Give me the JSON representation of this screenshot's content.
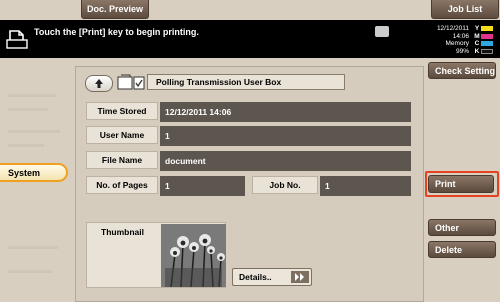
{
  "top": {
    "doc_preview": "Doc. Preview",
    "job_list": "Job List"
  },
  "message": {
    "text": "Touch the [Print] key to begin printing."
  },
  "status": {
    "date": "12/12/2011",
    "time": "14:06",
    "memory_label": "Memory",
    "memory_value": "99%",
    "toner": [
      {
        "letter": "Y",
        "color": "#f2dc1e"
      },
      {
        "letter": "M",
        "color": "#e0338f"
      },
      {
        "letter": "C",
        "color": "#2fa6e0"
      },
      {
        "letter": "K",
        "color": "#111111"
      }
    ]
  },
  "left": {
    "system_tab": "System"
  },
  "right": {
    "check_setting": "Check Setting",
    "print": "Print",
    "other": "Other",
    "delete": "Delete"
  },
  "panel": {
    "title": "Polling Transmission User Box",
    "fields": {
      "time_stored_label": "Time Stored",
      "time_stored_value": "12/12/2011 14:06",
      "user_name_label": "User Name",
      "user_name_value": "1",
      "file_name_label": "File Name",
      "file_name_value": "document",
      "pages_label": "No. of Pages",
      "pages_value": "1",
      "job_no_label": "Job No.",
      "job_no_value": "1"
    },
    "thumbnail_label": "Thumbnail",
    "details_button": "Details.."
  },
  "colors": {
    "accent_orange": "#f0a020",
    "dark_bar": "#000000",
    "print_border": "#e3431f"
  }
}
